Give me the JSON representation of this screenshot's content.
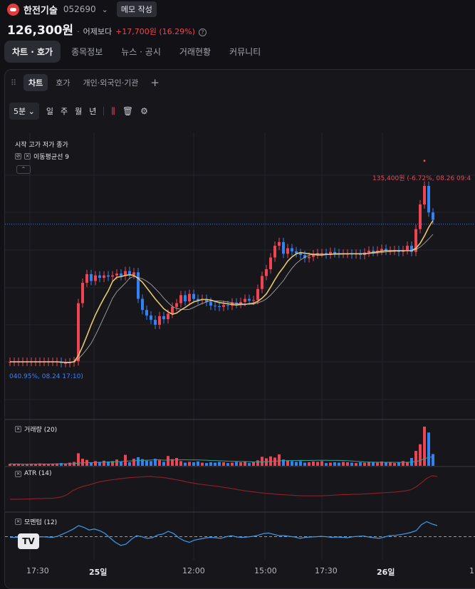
{
  "stock": {
    "name": "한전기술",
    "code": "052690",
    "memo_label": "메모 작성",
    "price": "126,300원",
    "compare_label": "어제보다",
    "change": "+17,700원 (16.29%)",
    "help_glyph": "?"
  },
  "main_tabs": [
    "차트 · 호가",
    "종목정보",
    "뉴스 · 공시",
    "거래현황",
    "커뮤니티"
  ],
  "chart_tabs": [
    "차트",
    "호가",
    "개인·외국인·기관"
  ],
  "add_tab_glyph": "+",
  "toolbar": {
    "interval": "5분",
    "timeframes": [
      "일",
      "주",
      "월",
      "년"
    ],
    "icons": [
      "candle-settings-icon",
      "trash-icon",
      "gear-icon"
    ]
  },
  "legend": {
    "ohlc_label": "시작 고가 저가 종가",
    "ma_label": "이동평균선 9"
  },
  "annotations": {
    "high": "135,400원 (-6.72%, 08.26 09:4",
    "low": "040.95%, 08.24 17:10)"
  },
  "indicators": {
    "volume": "거래량 (20)",
    "atr": "ATR (14)",
    "momentum": "모멘텀 (12)"
  },
  "x_ticks": [
    "17:30",
    "25일",
    "12:00",
    "15:00",
    "17:30",
    "26일",
    "1"
  ],
  "colors": {
    "up": "#f04452",
    "down": "#3182f6",
    "ma9": "#e8c76b",
    "ma_grey": "#c8c8c8",
    "dotted_price_line": "#3b82f6"
  },
  "chart_data": {
    "type": "candlestick",
    "y_min": 95000,
    "y_max": 140000,
    "price_line": 126300,
    "series_close": [
      104000,
      104000,
      104000,
      104000,
      104000,
      104000,
      104000,
      104000,
      104000,
      104000,
      104000,
      104000,
      103800,
      103800,
      103900,
      104100,
      113500,
      116800,
      118200,
      117100,
      118000,
      117600,
      118000,
      117800,
      118000,
      118300,
      117900,
      118700,
      118100,
      118500,
      114200,
      112400,
      111500,
      110800,
      110000,
      111400,
      110900,
      111800,
      112900,
      113500,
      114800,
      113800,
      115000,
      114200,
      114000,
      114200,
      113700,
      113100,
      113000,
      112900,
      113200,
      113100,
      113600,
      113400,
      113700,
      114200,
      113900,
      114000,
      115800,
      117900,
      119000,
      120900,
      122800,
      123400,
      121500,
      122400,
      121900,
      121600,
      121300,
      120800,
      121000,
      121400,
      121600,
      121600,
      121400,
      121800,
      121600,
      121500,
      121500,
      121500,
      121400,
      121500,
      121300,
      121700,
      122000,
      121800,
      122000,
      122300,
      122000,
      122000,
      122100,
      121800,
      122100,
      122800,
      121800,
      125500,
      129500,
      132500,
      128200,
      127000
    ],
    "ma9": [
      104000,
      104000,
      104000,
      104000,
      104000,
      104000,
      104000,
      104000,
      104000,
      104000,
      104000,
      104000,
      103950,
      103900,
      103900,
      104000,
      105000,
      106500,
      108200,
      110000,
      111600,
      113000,
      114300,
      115500,
      117000,
      117700,
      117800,
      118000,
      118100,
      118000,
      117500,
      116900,
      116000,
      115100,
      114200,
      113400,
      112600,
      112100,
      111700,
      111900,
      112400,
      112800,
      113300,
      113700,
      113900,
      114100,
      114100,
      114000,
      113800,
      113600,
      113500,
      113400,
      113300,
      113200,
      113300,
      113300,
      113400,
      113500,
      113800,
      114300,
      115000,
      116100,
      117300,
      118400,
      119300,
      120300,
      121000,
      121500,
      121700,
      121600,
      121500,
      121400,
      121300,
      121300,
      121400,
      121400,
      121500,
      121500,
      121500,
      121500,
      121500,
      121500,
      121500,
      121500,
      121600,
      121700,
      121800,
      121900,
      122000,
      122000,
      122000,
      122000,
      122000,
      122000,
      122000,
      122400,
      123200,
      124400,
      125800,
      126900
    ],
    "volume_rel": [
      0.05,
      0.04,
      0.05,
      0.03,
      0.04,
      0.05,
      0.04,
      0.06,
      0.05,
      0.05,
      0.05,
      0.06,
      0.07,
      0.06,
      0.08,
      0.1,
      0.32,
      0.18,
      0.15,
      0.09,
      0.12,
      0.1,
      0.13,
      0.11,
      0.12,
      0.16,
      0.1,
      0.28,
      0.09,
      0.18,
      0.22,
      0.17,
      0.13,
      0.12,
      0.18,
      0.14,
      0.1,
      0.25,
      0.17,
      0.2,
      0.12,
      0.08,
      0.1,
      0.09,
      0.11,
      0.08,
      0.07,
      0.09,
      0.08,
      0.1,
      0.09,
      0.07,
      0.08,
      0.1,
      0.09,
      0.11,
      0.07,
      0.1,
      0.14,
      0.23,
      0.19,
      0.24,
      0.21,
      0.29,
      0.16,
      0.14,
      0.12,
      0.1,
      0.12,
      0.08,
      0.09,
      0.11,
      0.1,
      0.12,
      0.07,
      0.08,
      0.09,
      0.08,
      0.1,
      0.09,
      0.08,
      0.07,
      0.09,
      0.08,
      0.1,
      0.09,
      0.08,
      0.11,
      0.09,
      0.1,
      0.07,
      0.09,
      0.12,
      0.1,
      0.2,
      0.38,
      0.55,
      1.0,
      0.85,
      0.3
    ],
    "atr": [
      0.25,
      0.25,
      0.25,
      0.26,
      0.26,
      0.27,
      0.27,
      0.28,
      0.28,
      0.3,
      0.33,
      0.4,
      0.52,
      0.6,
      0.66,
      0.7,
      0.75,
      0.8,
      0.83,
      0.86,
      0.88,
      0.9,
      0.92,
      0.94,
      0.95,
      0.96,
      0.97,
      0.98,
      0.96,
      0.95,
      0.93,
      0.9,
      0.87,
      0.84,
      0.8,
      0.77,
      0.74,
      0.72,
      0.7,
      0.68,
      0.66,
      0.63,
      0.61,
      0.58,
      0.55,
      0.52,
      0.5,
      0.48,
      0.46,
      0.44,
      0.43,
      0.41,
      0.4,
      0.39,
      0.38,
      0.37,
      0.36,
      0.36,
      0.36,
      0.36,
      0.36,
      0.37,
      0.38,
      0.39,
      0.4,
      0.4,
      0.41,
      0.41,
      0.42,
      0.43,
      0.44,
      0.45,
      0.46,
      0.47,
      0.48,
      0.5,
      0.52,
      0.56,
      0.65,
      0.78,
      0.92,
      1.0,
      0.98
    ],
    "momentum": [
      0.5,
      0.5,
      0.5,
      0.5,
      0.5,
      0.5,
      0.52,
      0.51,
      0.5,
      0.53,
      0.6,
      0.67,
      0.75,
      0.85,
      0.8,
      0.72,
      0.75,
      0.7,
      0.62,
      0.48,
      0.35,
      0.26,
      0.3,
      0.44,
      0.55,
      0.52,
      0.47,
      0.49,
      0.57,
      0.6,
      0.68,
      0.62,
      0.49,
      0.4,
      0.35,
      0.42,
      0.45,
      0.48,
      0.5,
      0.49,
      0.47,
      0.52,
      0.55,
      0.51,
      0.5,
      0.51,
      0.53,
      0.56,
      0.61,
      0.63,
      0.59,
      0.55,
      0.55,
      0.53,
      0.51,
      0.47,
      0.5,
      0.51,
      0.52,
      0.53,
      0.52,
      0.5,
      0.51,
      0.5,
      0.49,
      0.52,
      0.53,
      0.54,
      0.51,
      0.49,
      0.47,
      0.51,
      0.55,
      0.56,
      0.58,
      0.61,
      0.65,
      0.7,
      0.88,
      0.97,
      0.9,
      0.85
    ],
    "momentum_zero": 0.52
  }
}
